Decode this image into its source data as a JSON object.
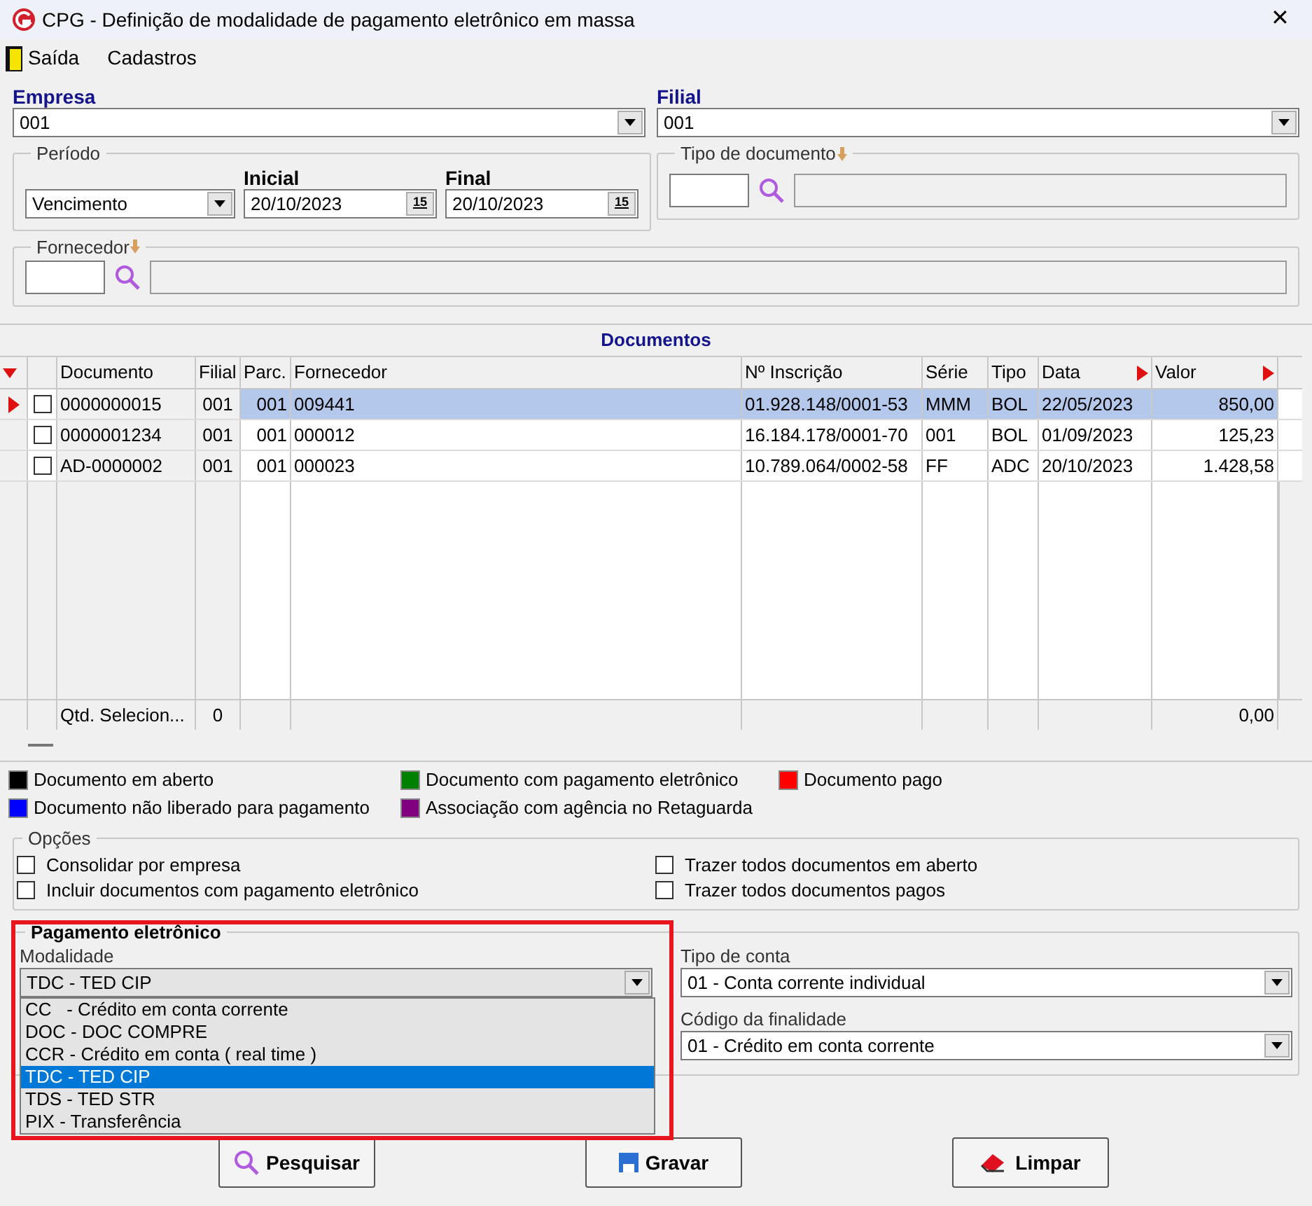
{
  "window": {
    "title": "CPG - Definição de modalidade de pagamento eletrônico em massa",
    "close": "✕"
  },
  "menu": [
    {
      "label": "Saída",
      "kind": "exit"
    },
    {
      "label": "Cadastros",
      "kind": "plain"
    }
  ],
  "empresa": {
    "label": "Empresa",
    "value": "001"
  },
  "filial": {
    "label": "Filial",
    "value": "001"
  },
  "periodo": {
    "label": "Período",
    "value": "Vencimento",
    "inicial": {
      "label": "Inicial",
      "value": "20/10/2023",
      "calendar": "15"
    },
    "final": {
      "label": "Final",
      "value": "20/10/2023",
      "calendar": "15"
    }
  },
  "tipo_documento": {
    "label": "Tipo de documento"
  },
  "fornecedor": {
    "label": "Fornecedor"
  },
  "documentos": {
    "title": "Documentos",
    "columns": [
      {
        "sort_marker": true
      },
      {
        "sort_marker": false
      },
      {
        "label": "Documento",
        "sort_marker": false
      },
      {
        "label": "Filial",
        "sort_marker": false
      },
      {
        "label": "Parc.",
        "sort_marker": false
      },
      {
        "label": "Fornecedor",
        "sort_marker": false
      },
      {
        "label": "Nº Inscrição",
        "sort_marker": false
      },
      {
        "label": "Série",
        "sort_marker": false
      },
      {
        "label": "Tipo",
        "sort_marker": false
      },
      {
        "label": "Data",
        "sort_marker": true
      },
      {
        "label": "Valor",
        "sort_marker": true
      }
    ],
    "rows": [
      {
        "selected": true,
        "checked": false,
        "documento": "0000000015",
        "filial": "001",
        "parc": "001",
        "fornecedor": "009441",
        "inscricao": "01.928.148/0001-53",
        "serie": "MMM",
        "tipo": "BOL",
        "data": "22/05/2023",
        "valor": "850,00"
      },
      {
        "selected": false,
        "checked": false,
        "documento": "0000001234",
        "filial": "001",
        "parc": "001",
        "fornecedor": "000012",
        "inscricao": "16.184.178/0001-70",
        "serie": "001",
        "tipo": "BOL",
        "data": "01/09/2023",
        "valor": "125,23"
      },
      {
        "selected": false,
        "checked": false,
        "documento": "AD-0000002",
        "filial": "001",
        "parc": "001",
        "fornecedor": "000023",
        "inscricao": "10.789.064/0002-58",
        "serie": "FF",
        "tipo": "ADC",
        "data": "20/10/2023",
        "valor": "1.428,58"
      }
    ],
    "footer": {
      "label": "Qtd. Selecion...",
      "count": "0",
      "total": "0,00"
    }
  },
  "legend": [
    {
      "label": "Documento em aberto",
      "color": "#000000"
    },
    {
      "label": "Documento com pagamento eletrônico",
      "color": "#008000"
    },
    {
      "label": "Documento pago",
      "color": "#ff0000"
    },
    {
      "label": "Documento não liberado para pagamento",
      "color": "#0000ff"
    },
    {
      "label": "Associação com agência no Retaguarda",
      "color": "#800080"
    }
  ],
  "opcoes": {
    "title": "Opções",
    "items": [
      {
        "label": "Consolidar por empresa",
        "checked": false
      },
      {
        "label": "Trazer todos documentos em aberto",
        "checked": false
      },
      {
        "label": "Incluir documentos com pagamento eletrônico",
        "checked": false
      },
      {
        "label": "Trazer todos documentos pagos",
        "checked": false
      }
    ]
  },
  "pagamento": {
    "title": "Pagamento eletrônico",
    "modalidade": {
      "label": "Modalidade",
      "value": "TDC - TED CIP",
      "expanded": true,
      "options": [
        {
          "label": "CC   - Crédito em conta corrente",
          "selected": false
        },
        {
          "label": "DOC - DOC COMPRE",
          "selected": false
        },
        {
          "label": "CCR - Crédito em conta ( real time )",
          "selected": false
        },
        {
          "label": "TDC - TED CIP",
          "selected": true
        },
        {
          "label": "TDS - TED STR",
          "selected": false
        },
        {
          "label": "PIX - Transferência",
          "selected": false
        }
      ]
    },
    "tipo_conta": {
      "label": "Tipo de conta",
      "value": "01 - Conta corrente individual"
    },
    "codigo_finalidade": {
      "label": "Código da finalidade",
      "value": "01 - Crédito em conta corrente"
    }
  },
  "buttons": [
    {
      "label": "Pesquisar",
      "kind": "search"
    },
    {
      "label": "Gravar",
      "kind": "save"
    },
    {
      "label": "Limpar",
      "kind": "clear"
    }
  ]
}
